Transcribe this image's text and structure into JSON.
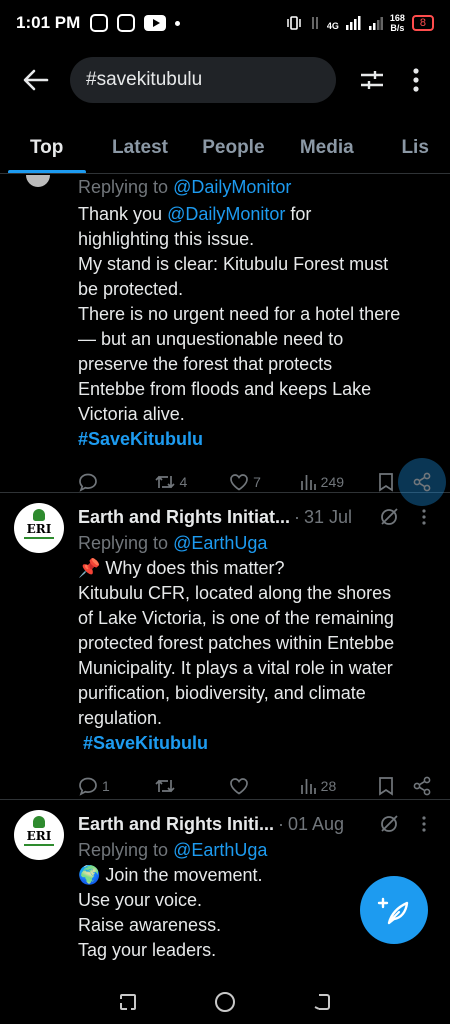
{
  "status_bar": {
    "time": "1:01 PM",
    "network": "4G",
    "speed_value": "168",
    "speed_unit": "B/s",
    "battery": "8"
  },
  "search": {
    "query": "#savekitubulu"
  },
  "tabs": [
    {
      "label": "Top",
      "active": true
    },
    {
      "label": "Latest",
      "active": false
    },
    {
      "label": "People",
      "active": false
    },
    {
      "label": "Media",
      "active": false
    },
    {
      "label": "Lis",
      "active": false
    }
  ],
  "posts": [
    {
      "replying_prefix": "Replying to ",
      "replying_handle": "@DailyMonitor",
      "body_lines": [
        "Thank you @DailyMonitor for",
        "highlighting this issue.",
        "My stand is clear: Kitubulu Forest must",
        "be protected.",
        "There is no urgent need for a hotel there",
        "— but an unquestionable need to",
        "preserve the forest that protects",
        "Entebbe from floods and keeps Lake",
        "Victoria alive."
      ],
      "mention_in_body": "@DailyMonitor",
      "hashtag": "#SaveKitubulu",
      "replies": "",
      "reposts": "4",
      "likes": "7",
      "views": "249"
    },
    {
      "author": "Earth and Rights Initiat...",
      "date": "31 Jul",
      "replying_prefix": "Replying to ",
      "replying_handle": "@EarthUga",
      "body_lines": [
        "📌 Why does this matter?",
        "Kitubulu CFR, located along the shores",
        "of Lake Victoria, is one of the remaining",
        "protected forest patches within Entebbe",
        "Municipality. It plays a vital role in water",
        "purification, biodiversity, and climate",
        "regulation."
      ],
      "hashtag": " #SaveKitubulu",
      "replies": "1",
      "reposts": "",
      "likes": "",
      "views": "28"
    },
    {
      "author": "Earth and Rights Initi...",
      "date": "01 Aug",
      "replying_prefix": "Replying to ",
      "replying_handle": "@EarthUga",
      "body_lines": [
        "🌍 Join the movement.",
        "Use your voice.",
        "Raise awareness.",
        "Tag your leaders."
      ]
    }
  ],
  "avatar_text": "ERI",
  "icons": {
    "back": "arrow-left-icon",
    "filter": "sliders-icon",
    "more": "vertical-dots-icon",
    "reply": "speech-bubble-icon",
    "repost": "repost-icon",
    "like": "heart-icon",
    "views": "bar-chart-icon",
    "bookmark": "bookmark-icon",
    "share": "share-icon",
    "grok": "grok-icon",
    "compose": "compose-feather-icon"
  },
  "colors": {
    "accent": "#1d9bf0",
    "background": "#000000",
    "muted": "#71767b",
    "text": "#e7e9ea"
  }
}
